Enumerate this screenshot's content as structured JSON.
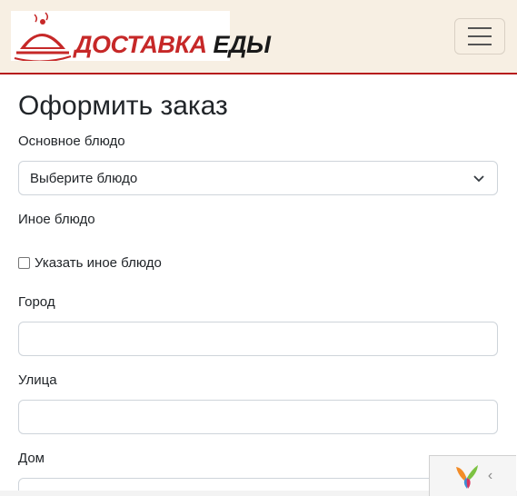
{
  "header": {
    "logo_text_red": "ДОСТАВКА ",
    "logo_text_dark": "ЕДЫ",
    "menu_icon": "hamburger-icon",
    "accent_color": "#c62828"
  },
  "form": {
    "title": "Оформить заказ",
    "main_dish_label": "Основное блюдо",
    "main_dish_select_value": "Выберите блюдо",
    "other_dish_label": "Иное блюдо",
    "other_dish_checkbox_label": "Указать иное блюдо",
    "city_label": "Город",
    "city_value": "",
    "street_label": "Улица",
    "street_value": "",
    "house_label": "Дом",
    "house_value": ""
  },
  "debug_toolbar": {
    "logo_icon": "yii-logo-icon",
    "toggle_icon": "chevron-left-icon",
    "toggle_glyph": "‹"
  }
}
